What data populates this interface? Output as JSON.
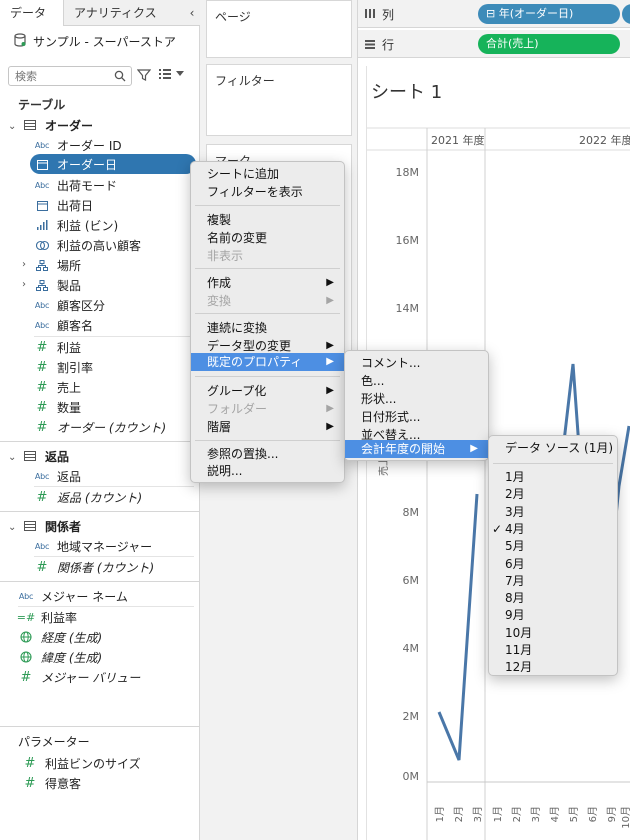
{
  "tabs": {
    "data": "データ",
    "analytics": "アナリティクス"
  },
  "datasource": "サンプル - スーパーストア",
  "search": {
    "placeholder": "検索"
  },
  "tables_header": "テーブル",
  "orders": {
    "name": "オーダー",
    "fields": [
      {
        "icon": "abc",
        "label": "オーダー ID"
      },
      {
        "icon": "cal",
        "label": "オーダー日"
      },
      {
        "icon": "abc",
        "label": "出荷モード"
      },
      {
        "icon": "cal",
        "label": "出荷日"
      },
      {
        "icon": "bin",
        "label": "利益 (ビン)"
      },
      {
        "icon": "set",
        "label": "利益の高い顧客"
      },
      {
        "icon": "hier",
        "label": "場所"
      },
      {
        "icon": "hier",
        "label": "製品"
      },
      {
        "icon": "abc",
        "label": "顧客区分"
      },
      {
        "icon": "abc",
        "label": "顧客名"
      },
      {
        "icon": "meas",
        "label": "利益"
      },
      {
        "icon": "meas",
        "label": "割引率"
      },
      {
        "icon": "meas",
        "label": "売上"
      },
      {
        "icon": "meas",
        "label": "数量"
      },
      {
        "icon": "meas",
        "label": "オーダー (カウント)"
      }
    ]
  },
  "returns": {
    "name": "返品",
    "fields": [
      {
        "icon": "abc",
        "label": "返品"
      },
      {
        "icon": "meas",
        "label": "返品 (カウント)"
      }
    ]
  },
  "people": {
    "name": "関係者",
    "fields": [
      {
        "icon": "abc",
        "label": "地域マネージャー"
      },
      {
        "icon": "meas",
        "label": "関係者 (カウント)"
      }
    ]
  },
  "loose_fields": [
    {
      "icon": "abc",
      "label": "メジャー ネーム"
    },
    {
      "icon": "calc",
      "label": "利益率"
    },
    {
      "icon": "geo",
      "label": "経度 (生成)"
    },
    {
      "icon": "geo",
      "label": "緯度 (生成)"
    },
    {
      "icon": "meas",
      "label": "メジャー バリュー"
    }
  ],
  "parameters": {
    "header": "パラメーター",
    "items": [
      "利益ビンのサイズ",
      "得意客"
    ]
  },
  "cards": {
    "pages": "ページ",
    "filters": "フィルター",
    "marks": "マーク"
  },
  "shelves": {
    "columns": "列",
    "rows": "行",
    "col_pill": "年(オーダー日)",
    "row_pill": "合計(売上)"
  },
  "sheet": {
    "title": "シート 1",
    "year_2021": "2021 年度",
    "year_2022": "2022 年度",
    "y_ticks": [
      "18M",
      "16M",
      "14M",
      "8M",
      "6M",
      "4M",
      "2M",
      "0M"
    ],
    "y_axis_label": "売上",
    "x_ticks": [
      "1月",
      "2月",
      "3月",
      "4月",
      "5月",
      "6月",
      "7月",
      "8月",
      "9月",
      "10月"
    ]
  },
  "chart_data": {
    "type": "line",
    "x": [
      "1月",
      "2月",
      "3月",
      "1月",
      "2月",
      "3月",
      "4月",
      "5月",
      "6月",
      "7月",
      "8月",
      "9月",
      "10月"
    ],
    "ylim": [
      0,
      19
    ],
    "y_ticks": [
      0,
      2,
      4,
      6,
      8,
      14,
      16,
      18
    ]
  },
  "menu": {
    "items": [
      "シートに追加",
      "フィルターを表示",
      "複製",
      "名前の変更",
      "非表示",
      "作成",
      "変換",
      "連続に変換",
      "データ型の変更",
      "既定のプロパティ",
      "グループ化",
      "フォルダー",
      "階層",
      "参照の置換...",
      "説明..."
    ]
  },
  "submenu": {
    "items": [
      "コメント...",
      "色...",
      "形状...",
      "日付形式...",
      "並べ替え...",
      "会計年度の開始"
    ]
  },
  "months_menu": {
    "header": "データ ソース (1月)",
    "checked": "4月",
    "items": [
      "1月",
      "2月",
      "3月",
      "4月",
      "5月",
      "6月",
      "7月",
      "8月",
      "9月",
      "10月",
      "11月",
      "12月"
    ]
  },
  "colors": {
    "selection": "#2f76b0",
    "menu_highlight": "#4d8fe3",
    "measure": "#16b35a",
    "dimension": "#3d8bb9",
    "line": "#4a77a8"
  }
}
